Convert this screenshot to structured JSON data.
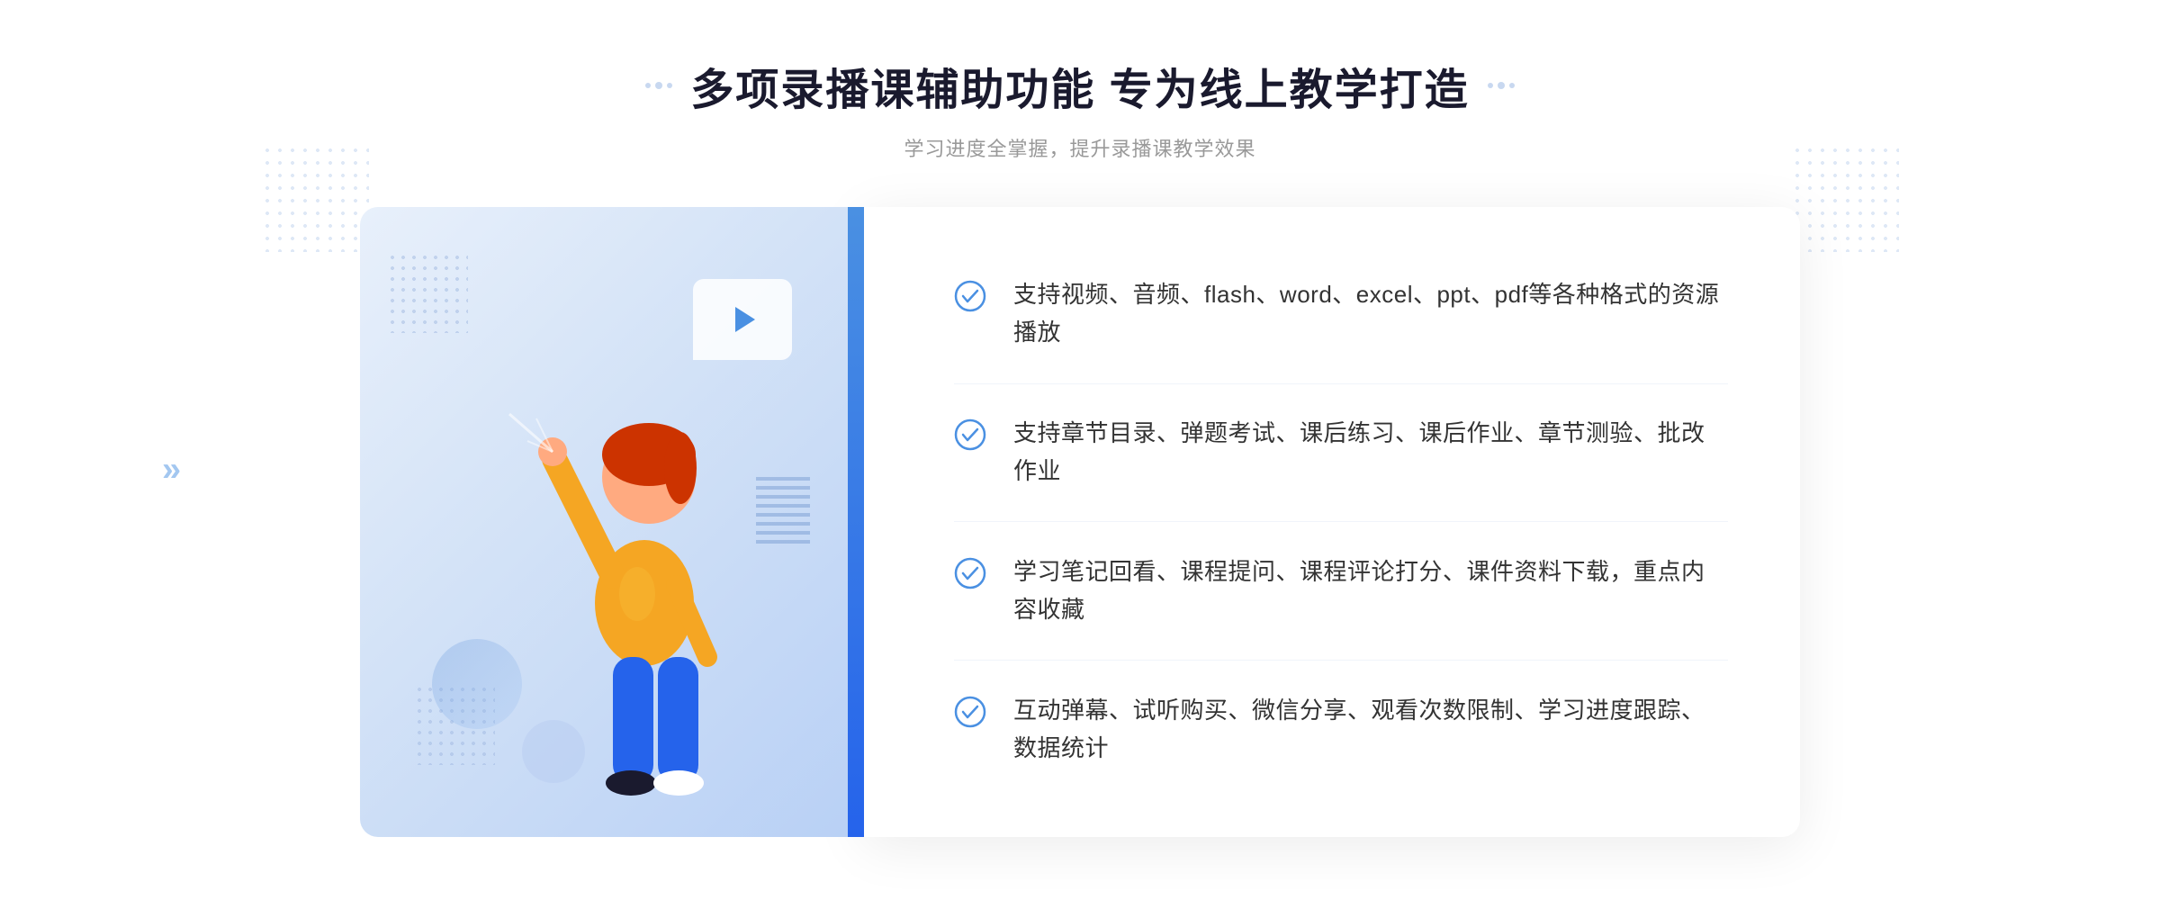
{
  "header": {
    "title": "多项录播课辅助功能 专为线上教学打造",
    "subtitle": "学习进度全掌握，提升录播课教学效果",
    "decoration_left": "❖",
    "decoration_right": "❖"
  },
  "features": [
    {
      "id": 1,
      "text": "支持视频、音频、flash、word、excel、ppt、pdf等各种格式的资源播放"
    },
    {
      "id": 2,
      "text": "支持章节目录、弹题考试、课后练习、课后作业、章节测验、批改作业"
    },
    {
      "id": 3,
      "text": "学习笔记回看、课程提问、课程评论打分、课件资料下载，重点内容收藏"
    },
    {
      "id": 4,
      "text": "互动弹幕、试听购买、微信分享、观看次数限制、学习进度跟踪、数据统计"
    }
  ],
  "colors": {
    "accent": "#4a90e2",
    "title": "#1a1a2e",
    "text": "#333333",
    "subtitle": "#999999",
    "check": "#4a90e2",
    "bg_light": "#e8f0fb"
  }
}
